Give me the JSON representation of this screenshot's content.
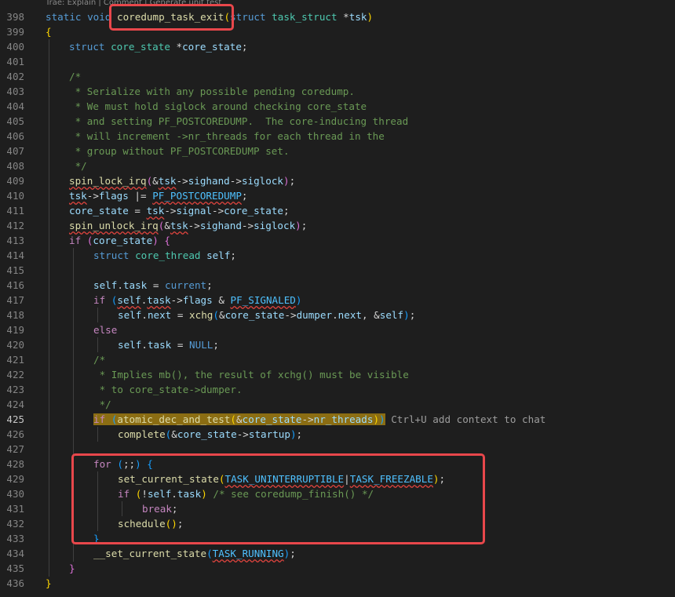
{
  "editor": {
    "codelens_text": "Trae: Explain | Comment | Generate unit test",
    "inline_hint": "Ctrl+U add context to chat",
    "active_line": "425"
  },
  "line_numbers": [
    "398",
    "399",
    "400",
    "401",
    "402",
    "403",
    "404",
    "405",
    "406",
    "407",
    "408",
    "409",
    "410",
    "411",
    "412",
    "413",
    "414",
    "415",
    "416",
    "417",
    "418",
    "419",
    "420",
    "421",
    "422",
    "423",
    "424",
    "425",
    "426",
    "427",
    "428",
    "429",
    "430",
    "431",
    "432",
    "433",
    "434",
    "435",
    "436"
  ],
  "code": {
    "l398": {
      "kw": "static void ",
      "fn": "coredump_task_exit",
      "lp": "(",
      "kw2": "struct ",
      "type": "task_struct",
      "star": " *",
      "param": "tsk",
      "rp": ")"
    },
    "l399": "{",
    "l400": {
      "kw": "struct ",
      "type": "core_state",
      "star": " *",
      "var": "core_state",
      "semi": ";"
    },
    "l402": "/*",
    "l403": " * Serialize with any possible pending coredump.",
    "l404": " * We must hold siglock around checking core_state",
    "l405": " * and setting PF_POSTCOREDUMP.  The core-inducing thread",
    "l406": " * will increment ->nr_threads for each thread in the",
    "l407": " * group without PF_POSTCOREDUMP set.",
    "l408": " */",
    "l409": {
      "fn": "spin_lock_irq",
      "lp": "(",
      "amp": "&",
      "v1": "tsk",
      "ar1": "->",
      "v2": "sighand",
      "ar2": "->",
      "v3": "siglock",
      "rp": ")",
      "semi": ";"
    },
    "l410": {
      "v1": "tsk",
      "ar": "->",
      "v2": "flags",
      "op": " |= ",
      "mac": "PF_POSTCOREDUMP",
      "semi": ";"
    },
    "l411": {
      "v1": "core_state",
      "op": " = ",
      "v2": "tsk",
      "ar1": "->",
      "v3": "signal",
      "ar2": "->",
      "v4": "core_state",
      "semi": ";"
    },
    "l412": {
      "fn": "spin_unlock_irq",
      "lp": "(",
      "amp": "&",
      "v1": "tsk",
      "ar1": "->",
      "v2": "sighand",
      "ar2": "->",
      "v3": "siglock",
      "rp": ")",
      "semi": ";"
    },
    "l413": {
      "kw": "if",
      "sp": " ",
      "lp": "(",
      "v": "core_state",
      "rp": ")",
      "br": " {"
    },
    "l414": {
      "kw": "struct ",
      "type": "core_thread",
      "sp": " ",
      "var": "self",
      "semi": ";"
    },
    "l416": {
      "v1": "self",
      "dot": ".",
      "v2": "task",
      "op": " = ",
      "v3": "current",
      "semi": ";"
    },
    "l417": {
      "kw": "if",
      "sp": " ",
      "lp": "(",
      "v1": "self",
      "dot": ".",
      "v2": "task",
      "ar": "->",
      "v3": "flags",
      "op": " & ",
      "mac": "PF_SIGNALED",
      "rp": ")"
    },
    "l418": {
      "v1": "self",
      "dot1": ".",
      "v2": "next",
      "op": " = ",
      "fn": "xchg",
      "lp": "(",
      "amp": "&",
      "v3": "core_state",
      "ar": "->",
      "v4": "dumper",
      "dot2": ".",
      "v5": "next",
      "comma": ", ",
      "amp2": "&",
      "v6": "self",
      "rp": ")",
      "semi": ";"
    },
    "l419": "else",
    "l420": {
      "v1": "self",
      "dot": ".",
      "v2": "task",
      "op": " = ",
      "mac": "NULL",
      "semi": ";"
    },
    "l421": "/*",
    "l422": " * Implies mb(), the result of xchg() must be visible",
    "l423": " * to core_state->dumper.",
    "l424": " */",
    "l425": {
      "kw": "if",
      "sp": " ",
      "lp": "(",
      "fn": "atomic_dec_and_test",
      "lp2": "(",
      "amp": "&",
      "v1": "core_state",
      "ar": "->",
      "v2": "nr_threads",
      "rp2": ")",
      "rp": ")"
    },
    "l426": {
      "fn": "complete",
      "lp": "(",
      "amp": "&",
      "v1": "core_state",
      "ar": "->",
      "v2": "startup",
      "rp": ")",
      "semi": ";"
    },
    "l428": {
      "kw": "for",
      "sp": " ",
      "lp": "(",
      "semis": ";;",
      "rp": ")",
      "br": " {"
    },
    "l429": {
      "fn": "set_current_state",
      "lp": "(",
      "mac1": "TASK_UNINTERRUPTIBLE",
      "pipe": "|",
      "mac2": "TASK_FREEZABLE",
      "rp": ")",
      "semi": ";"
    },
    "l430": {
      "kw": "if",
      "sp": " ",
      "lp": "(",
      "not": "!",
      "v1": "self",
      "dot": ".",
      "v2": "task",
      "rp": ")",
      "cm": " /* see coredump_finish() */"
    },
    "l431": {
      "kw": "break",
      "semi": ";"
    },
    "l432": {
      "fn": "schedule",
      "lp": "(",
      "rp": ")",
      "semi": ";"
    },
    "l433": "}",
    "l434": {
      "fn": "__set_current_state",
      "lp": "(",
      "mac": "TASK_RUNNING",
      "rp": ")",
      "semi": ";"
    },
    "l435": "}",
    "l436": "}"
  }
}
